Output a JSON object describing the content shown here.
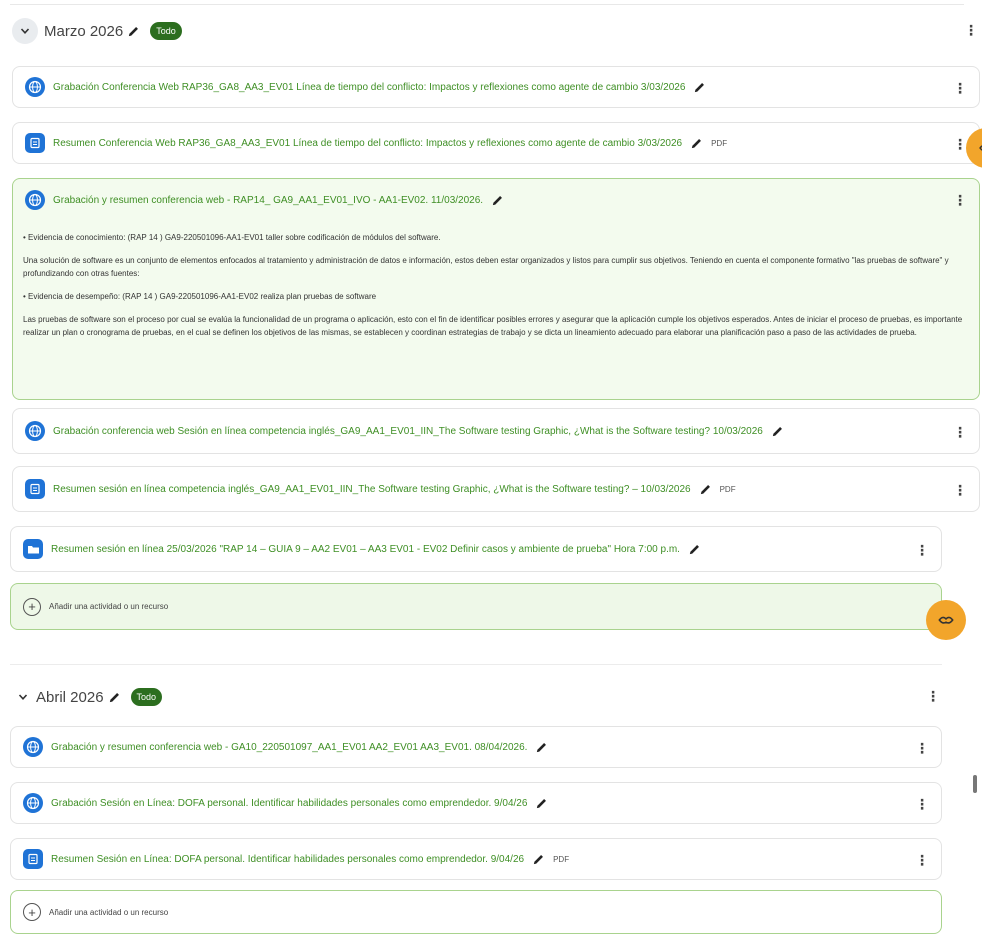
{
  "colors": {
    "link": "#3f8f25",
    "badge": "#2c6e1f",
    "icon_blue": "#1f73d6",
    "highlight_bg": "#f3fbee",
    "fab": "#f2a52b"
  },
  "sections": [
    {
      "title": "Marzo 2026",
      "badge": "Todo",
      "items": [
        {
          "icon": "globe-icon",
          "text": "Grabación Conferencia Web RAP36_GA8_AA3_EV01 Línea de tiempo del conflicto: Impactos y reflexiones como agente de cambio 3/03/2026",
          "pdf": ""
        },
        {
          "icon": "document-icon",
          "text": "Resumen Conferencia Web RAP36_GA8_AA3_EV01 Línea de tiempo del conflicto: Impactos y reflexiones como agente de cambio 3/03/2026",
          "pdf": "PDF"
        },
        {
          "icon": "globe-icon",
          "text": "Grabación y resumen conferencia web - RAP14_ GA9_AA1_EV01_IVO - AA1-EV02. 11/03/2026.",
          "pdf": "",
          "description": [
            "• Evidencia de conocimiento: (RAP 14 ) GA9-220501096-AA1-EV01 taller sobre codificación de módulos del software.",
            "Una solución de software es un conjunto de elementos enfocados al tratamiento y administración de datos e información, estos deben estar organizados y listos para cumplir sus objetivos. Teniendo en cuenta el componente formativo \"las pruebas de software\" y profundizando con otras fuentes:",
            "• Evidencia de desempeño: (RAP 14 ) GA9-220501096-AA1-EV02 realiza plan pruebas de software",
            "Las pruebas de software son el proceso por cual se evalúa la funcionalidad de un programa o aplicación, esto con el fin de identificar posibles errores y asegurar que la aplicación cumple los objetivos esperados. Antes de iniciar el proceso de pruebas, es importante realizar un plan o cronograma de pruebas, en el cual se definen los objetivos de las mismas, se establecen y coordinan estrategias de trabajo y se dicta un lineamiento adecuado para elaborar una planificación paso a paso de las actividades de prueba."
          ]
        },
        {
          "icon": "globe-icon",
          "text": "Grabación conferencia web Sesión en línea competencia inglés_GA9_AA1_EV01_IIN_The Software testing Graphic, ¿What is the Software testing? 10/03/2026",
          "pdf": ""
        },
        {
          "icon": "document-icon",
          "text": "Resumen sesión en línea competencia inglés_GA9_AA1_EV01_IIN_The Software testing Graphic, ¿What is the Software testing? – 10/03/2026",
          "pdf": "PDF"
        },
        {
          "icon": "folder-icon",
          "text": "Resumen sesión en línea 25/03/2026 \"RAP 14 – GUIA 9 – AA2 EV01 – AA3 EV01 - EV02 Definir casos y ambiente de prueba\" Hora 7:00 p.m.",
          "pdf": ""
        }
      ],
      "add_label": "Añadir una actividad o un recurso"
    },
    {
      "title": "Abril 2026",
      "badge": "Todo",
      "items": [
        {
          "icon": "globe-icon",
          "text": "Grabación y resumen conferencia web - GA10_220501097_AA1_EV01 AA2_EV01 AA3_EV01. 08/04/2026.",
          "pdf": ""
        },
        {
          "icon": "globe-icon",
          "text": "Grabación Sesión en Línea: DOFA personal. Identificar habilidades personales como emprendedor. 9/04/26",
          "pdf": ""
        },
        {
          "icon": "document-icon",
          "text": "Resumen Sesión en Línea: DOFA personal. Identificar habilidades personales como emprendedor. 9/04/26",
          "pdf": "PDF"
        }
      ],
      "add_label": "Añadir una actividad o un recurso"
    }
  ]
}
